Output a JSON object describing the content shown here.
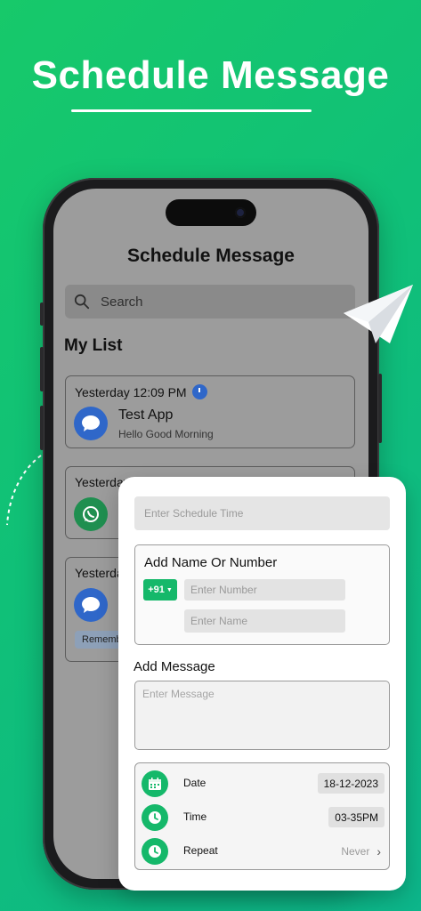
{
  "promo": {
    "title": "Schedule Message"
  },
  "screen": {
    "title": "Schedule Message",
    "search_placeholder": "Search",
    "section_title": "My List",
    "cards": [
      {
        "time": "Yesterday 12:09 PM",
        "app": "message",
        "name": "Test App",
        "message": "Hello Good Morning"
      },
      {
        "time": "Yesterday",
        "app": "whatsapp"
      },
      {
        "time": "Yesterday",
        "app": "message",
        "chip": "Rememb"
      }
    ]
  },
  "form": {
    "schedule_time_placeholder": "Enter Schedule Time",
    "name_section_title": "Add Name Or Number",
    "country_code": "+91",
    "number_placeholder": "Enter Number",
    "name_placeholder": "Enter Name",
    "message_label": "Add Message",
    "message_placeholder": "Enter Message",
    "settings": {
      "date_label": "Date",
      "date_value": "18-12-2023",
      "time_label": "Time",
      "time_value": "03-35PM",
      "repeat_label": "Repeat",
      "repeat_value": "Never"
    }
  },
  "colors": {
    "accent": "#15b86a",
    "clock_badge": "#2f67c9",
    "message_icon": "#2f67c9",
    "whatsapp_icon": "#1f8f50"
  }
}
